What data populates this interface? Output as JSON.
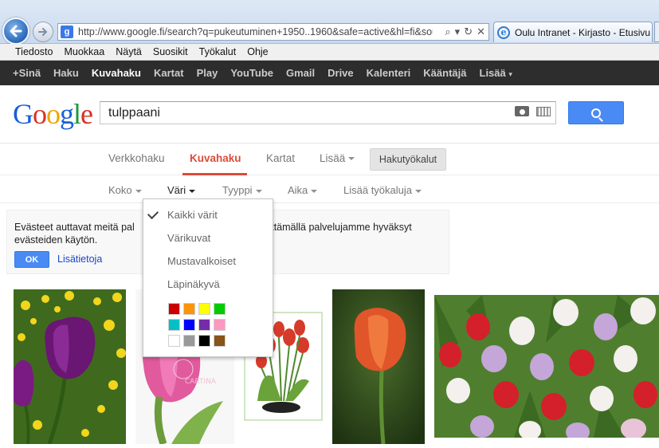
{
  "browser": {
    "url": "http://www.google.fi/search?q=pukeutuminen+1950..1960&safe=active&hl=fi&sour",
    "tab_title": "Oulu Intranet - Kirjasto - Etusivu",
    "favicon_letter": "g",
    "menu": [
      "Tiedosto",
      "Muokkaa",
      "Näytä",
      "Suosikit",
      "Työkalut",
      "Ohje"
    ]
  },
  "gbar": {
    "items": [
      "+Sinä",
      "Haku",
      "Kuvahaku",
      "Kartat",
      "Play",
      "YouTube",
      "Gmail",
      "Drive",
      "Kalenteri",
      "Kääntäjä",
      "Lisää"
    ],
    "active_index": 2
  },
  "logo": {
    "text": "Google"
  },
  "search": {
    "query": "tulppaani"
  },
  "search_tabs": {
    "items": [
      "Verkkohaku",
      "Kuvahaku",
      "Kartat",
      "Lisää"
    ],
    "selected": "Kuvahaku",
    "tools_button": "Hakutyökalut"
  },
  "tools": {
    "items": [
      "Koko",
      "Väri",
      "Tyyppi",
      "Aika",
      "Lisää työkaluja"
    ],
    "open": "Väri"
  },
  "cookie": {
    "text_left": "Evästeet auttavat meitä pal",
    "text_right": "käyttämällä palvelujamme hyväksyt",
    "text_line2": "evästeiden käytön.",
    "ok_label": "OK",
    "more_label": "Lisätietoja"
  },
  "color_menu": {
    "options": [
      "Kaikki värit",
      "Värikuvat",
      "Mustavalkoiset",
      "Läpinäkyvä"
    ],
    "checked": "Kaikki värit",
    "swatches": [
      "#cc0000",
      "#fb940b",
      "#ffff00",
      "#00cc00",
      "#03c0c6",
      "#0000ff",
      "#762ca7",
      "#ff98bf",
      "#ffffff",
      "#999999",
      "#000000",
      "#885418"
    ]
  },
  "results": {
    "images": [
      "purple-tulips",
      "pink-tulip-cartina",
      "red-tulips-pot",
      "orange-tulip",
      "tulip-bouquet"
    ],
    "watermark": "CARTINA"
  }
}
